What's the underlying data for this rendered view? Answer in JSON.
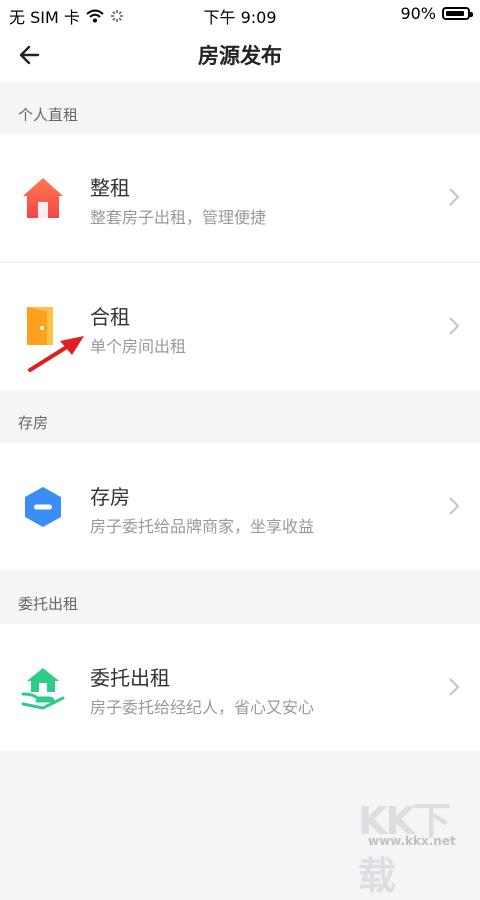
{
  "status_bar": {
    "carrier": "无 SIM 卡",
    "time": "下午 9:09",
    "battery_text": "90%",
    "battery_level": 0.9
  },
  "nav": {
    "title": "房源发布",
    "back_icon": "arrow-left-icon"
  },
  "sections": [
    {
      "header": "个人直租",
      "items": [
        {
          "title": "整租",
          "subtitle": "整套房子出租，管理便捷",
          "icon": "house-icon"
        },
        {
          "title": "合租",
          "subtitle": "单个房间出租",
          "icon": "door-icon"
        }
      ]
    },
    {
      "header": "存房",
      "items": [
        {
          "title": "存房",
          "subtitle": "房子委托给品牌商家，坐享收益",
          "icon": "hexagon-icon"
        }
      ]
    },
    {
      "header": "委托出租",
      "items": [
        {
          "title": "委托出租",
          "subtitle": "房子委托给经纪人，省心又安心",
          "icon": "handover-house-icon"
        }
      ]
    }
  ],
  "watermark": {
    "main": "KK下载",
    "sub": "www.kkx.net"
  },
  "colors": {
    "house_icon": "#f45b46",
    "door_icon": "#ffa620",
    "hexagon_icon": "#3a8ef6",
    "handover_icon": "#2ecc8a",
    "annotation_arrow": "#e02020"
  }
}
